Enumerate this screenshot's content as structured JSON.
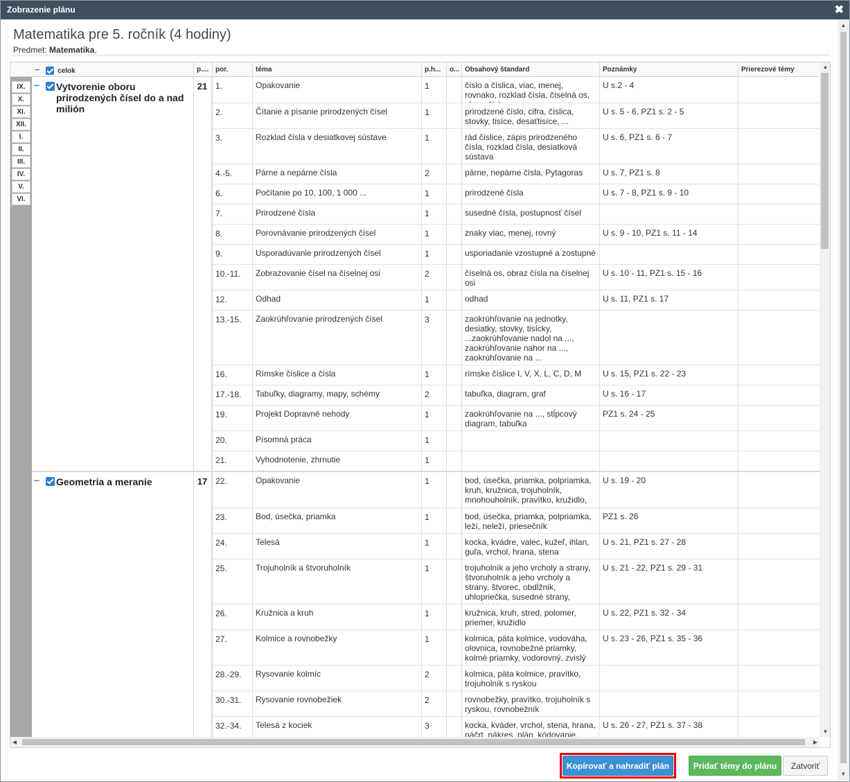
{
  "window": {
    "title": "Zobrazenie plánu",
    "close_glyph": "✖"
  },
  "plan": {
    "title": "Matematika pre 5. ročník (4 hodiny)",
    "subject_label": "Predmet:",
    "subject_value": "Matematika",
    "subject_suffix": ","
  },
  "columns": {
    "celok": "celok",
    "p": "p....",
    "por": "por.",
    "tema": "téma",
    "ph": "p.h...",
    "o": "o...",
    "standard": "Obsahový štandard",
    "notes": "Poznámky",
    "cross": "Prierezové témy"
  },
  "months": [
    "IX.",
    "X.",
    "XI.",
    "XII.",
    "I.",
    "II.",
    "III.",
    "IV.",
    "V.",
    "VI."
  ],
  "units": [
    {
      "name": "Vytvorenie oboru prirodzených čísel do a nad milión",
      "hours": "21",
      "rows": [
        {
          "por": "1.",
          "tema": "Opakovanie",
          "ph": "1",
          "std": "číslo a číslica, viac, menej, rovnako, rozklad čísla, číselná os, obraz čísla",
          "note": "U s.2 - 4"
        },
        {
          "por": "2.",
          "tema": "Čítanie a písanie prirodzených čísel",
          "ph": "1",
          "std": "prirodzené číslo, cifra, číslica, stovky, tisíce, desaťtisíce, ...",
          "note": "U s. 5 - 6, PZ1 s. 2 - 5"
        },
        {
          "por": "3.",
          "tema": "Rozklad čísla v desiatkovej sústave",
          "ph": "1",
          "std": "rád číslice, zápis prirodzeného čísla, rozklad čísla, desiatková sústava",
          "note": "U s. 6, PZ1 s. 6 - 7"
        },
        {
          "por": "4.-5.",
          "tema": "Párne a nepárne čísla",
          "ph": "2",
          "std": "párne, nepárne čísla, Pytagoras",
          "note": "U s. 7, PZ1 s. 8"
        },
        {
          "por": "6.",
          "tema": "Počítanie po 10, 100, 1 000 ...",
          "ph": "1",
          "std": "prirodzené čísla",
          "note": "U s. 7 - 8, PZ1 s. 9 - 10"
        },
        {
          "por": "7.",
          "tema": "Prirodzené čísla",
          "ph": "1",
          "std": "susedné čísla, postupnosť čísel",
          "note": ""
        },
        {
          "por": "8.",
          "tema": "Porovnávanie prirodzených čísel",
          "ph": "1",
          "std": "znaky viac, menej, rovný",
          "note": "U s. 9 - 10, PZ1 s. 11 - 14"
        },
        {
          "por": "9.",
          "tema": "Usporadúvanie prirodzených čísel",
          "ph": "1",
          "std": "usporiadanie vzostupné a zostupné",
          "note": ""
        },
        {
          "por": "10.-11.",
          "tema": "Zobrazovanie čísel na číselnej osi",
          "ph": "2",
          "std": "číselná os, obraz čísla na číselnej osi",
          "note": "U s. 10 - 11, PZ1 s. 15 - 16"
        },
        {
          "por": "12.",
          "tema": "Odhad",
          "ph": "1",
          "std": "odhad",
          "note": "U s. 11, PZ1 s. 17"
        },
        {
          "por": "13.-15.",
          "tema": "Zaokrúhľovanie prirodzených čísel",
          "ph": "3",
          "std": "zaokrúhľovanie na jednotky, desiatky, stovky, tisícky, ...zaokrúhľovanie nadol na ..., zaokrúhľovanie nahor na ..., zaokrúhľovanie na ...",
          "note": ""
        },
        {
          "por": "16.",
          "tema": "Rímske číslice a čísla",
          "ph": "1",
          "std": "rímske číslice I, V, X, L, C, D, M",
          "note": "U s. 15, PZ1 s. 22 - 23"
        },
        {
          "por": "17.-18.",
          "tema": "Tabuľky, diagramy, mapy, schémy",
          "ph": "2",
          "std": "tabuľka, diagram, graf",
          "note": "U s. 16 - 17"
        },
        {
          "por": "19.",
          "tema": "Projekt Dopravné nehody",
          "ph": "1",
          "std": "zaokrúhľovanie na ..., stĺpcový diagram, tabuľka",
          "note": "PZ1 s. 24 - 25"
        },
        {
          "por": "20.",
          "tema": "Písomná práca",
          "ph": "1",
          "std": "",
          "note": ""
        },
        {
          "por": "21.",
          "tema": "Vyhodnotenie, zhrnutie",
          "ph": "1",
          "std": "",
          "note": ""
        }
      ]
    },
    {
      "name": "Geometria a meranie",
      "hours": "17",
      "rows": [
        {
          "por": "22.",
          "tema": "Opakovanie",
          "ph": "1",
          "std": "bod, úsečka, priamka, polpriamka, kruh, kružnica, trojuholník, mnohouholník, pravítko, kružidlo,",
          "note": "U s. 19 - 20"
        },
        {
          "por": "23.",
          "tema": "Bod, úsečka, priamka",
          "ph": "1",
          "std": "bod, úsečka, priamka, polpriamka, leží, neleží, priesečník",
          "note": "PZ1 s. 26"
        },
        {
          "por": "24.",
          "tema": "Telesá",
          "ph": "1",
          "std": "kocka, kvádre, valec, kužeľ, ihlan, guľa, vrchol, hrana, stena",
          "note": "U s. 21, PZ1 s. 27 - 28"
        },
        {
          "por": "25.",
          "tema": "Trojuholník a štvoruholník",
          "ph": "1",
          "std": "trojuholník a jeho vrcholy a strany, štvoruholník a jeho vrcholy a strany, štvorec, obdĺžnik, uhlopriečka, susedné strany, protiľahlé strany",
          "note": "U s. 21 - 22, PZ1 s. 29 - 31"
        },
        {
          "por": "26.",
          "tema": "Kružnica a kruh",
          "ph": "1",
          "std": "kružnica, kruh, stred, polomer, priemer, kružidlo",
          "note": "U s. 22, PZ1 s. 32 - 34"
        },
        {
          "por": "27.",
          "tema": "Kolmice a rovnobežky",
          "ph": "1",
          "std": "kolmica, päta kolmice, vodováha, olovnica, rovnobežné priamky, kolmé priamky, vodorovný, zvislý",
          "note": "U s. 23 - 26, PZ1 s. 35 - 36"
        },
        {
          "por": "28.-29.",
          "tema": "Rysovanie kolmíc",
          "ph": "2",
          "std": "kolmica, päta kolmice, pravítko, trojuholník s ryskou",
          "note": ""
        },
        {
          "por": "30.-31.",
          "tema": "Rysovanie rovnobežiek",
          "ph": "2",
          "std": "rovnobežky, pravítko, trojuholník s ryskou, rovnobežník",
          "note": ""
        },
        {
          "por": "32.-34.",
          "tema": "Telesá z kociek",
          "ph": "3",
          "std": "kocka, kváder, vrchol, stena, hrana, náčrt, nákres, plán, kódovanie,",
          "note": "U s. 26 - 27, PZ1 s. 37 - 38"
        }
      ]
    }
  ],
  "buttons": {
    "copy": "Kopírovať a nahradiť plán",
    "add": "Pridať témy do plánu",
    "close": "Zatvoriť"
  }
}
